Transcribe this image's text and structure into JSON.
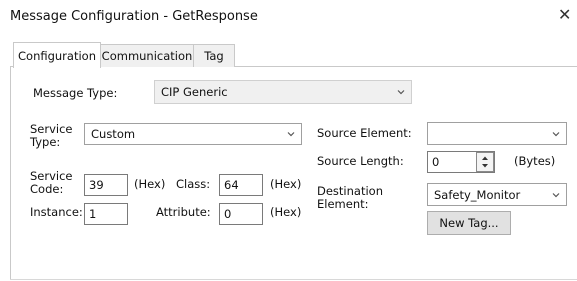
{
  "window": {
    "title": "Message Configuration - GetResponse",
    "close_glyph": "✕"
  },
  "tabs": [
    {
      "label": "Configuration",
      "active": true
    },
    {
      "label": "Communication",
      "active": false
    },
    {
      "label": "Tag",
      "active": false
    }
  ],
  "config": {
    "message_type_label": "Message Type:",
    "message_type_value": "CIP Generic",
    "service_type_label_1": "Service",
    "service_type_label_2": "Type:",
    "service_type_value": "Custom",
    "service_code_label_1": "Service",
    "service_code_label_2": "Code:",
    "service_code_value": "39",
    "hex_label": "(Hex)",
    "class_label": "Class:",
    "class_value": "64",
    "instance_label": "Instance:",
    "instance_value": "1",
    "attribute_label": "Attribute:",
    "attribute_value": "0",
    "source_element_label": "Source Element:",
    "source_element_value": "",
    "source_length_label": "Source Length:",
    "source_length_value": "0",
    "bytes_label": "(Bytes)",
    "destination_label_1": "Destination",
    "destination_label_2": "Element:",
    "destination_value": "Safety_Monitor",
    "new_tag_button": "New Tag..."
  },
  "icons": {
    "dropdown": "chevron-down-icon",
    "spin": "spin-arrows-icon",
    "close": "close-icon"
  }
}
